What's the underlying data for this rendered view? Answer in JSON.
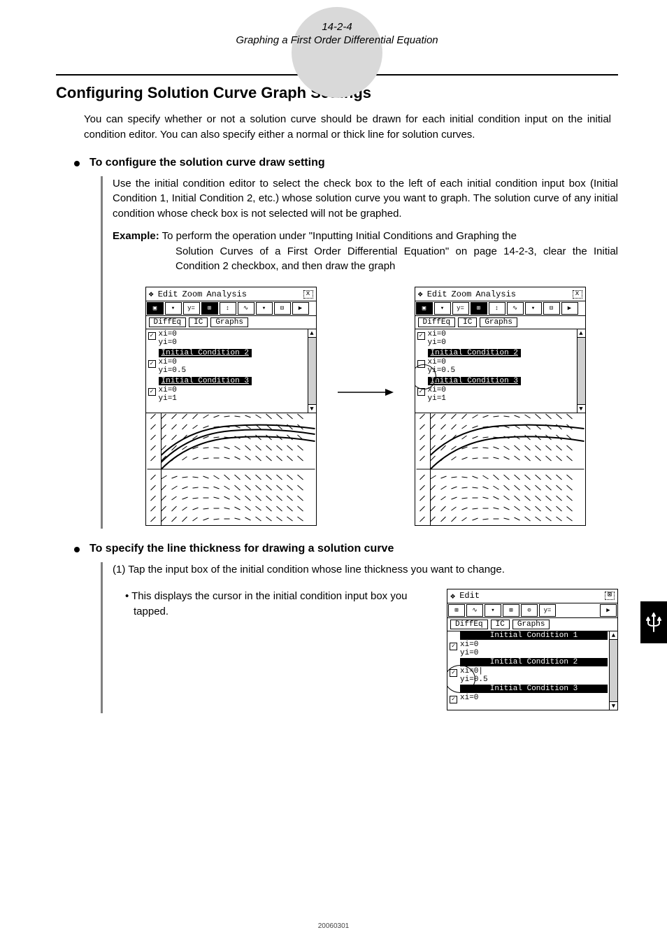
{
  "header": {
    "page_number": "14-2-4",
    "subtitle": "Graphing a First Order Differential Equation"
  },
  "section": {
    "title": "Configuring Solution Curve Graph Settings",
    "intro": "You can specify whether or not a solution curve should be drawn for each initial condition input on the initial condition editor. You can also specify either a normal or thick line for solution curves."
  },
  "sub1": {
    "heading": "To configure the solution curve draw setting",
    "para": "Use the initial condition editor to select the check box to the left of each initial condition input box (Initial Condition 1, Initial Condition 2, etc.) whose solution curve you want to graph. The solution curve of any initial condition whose check box is not selected will not be graphed.",
    "example_label": "Example:",
    "example_text_1": "To perform the operation under \"Inputting Initial Conditions and Graphing the",
    "example_text_2": "Solution Curves of a First Order Differential Equation\" on page 14-2-3, clear the Initial Condition 2 checkbox, and then draw the graph"
  },
  "calc_common": {
    "menus": [
      "Edit",
      "Zoom",
      "Analysis"
    ],
    "tabs": [
      "DiffEq",
      "IC",
      "Graphs"
    ],
    "cond1_xi": "xi=0",
    "cond1_yi": "yi=0",
    "sep2": "Initial Condition 2",
    "cond2_xi": "xi=0",
    "cond2_yi": "yi=0.5",
    "sep3": "Initial Condition 3",
    "cond3_xi": "xi=0",
    "cond3_yi": "yi=1"
  },
  "sub2": {
    "heading": "To specify the line thickness for drawing a solution curve",
    "step1": "(1) Tap the input box of the initial condition whose line thickness you want to change.",
    "bullet1": "• This displays the cursor in the initial condition input box you tapped."
  },
  "small_screen": {
    "menu": "Edit",
    "tabs": [
      "DiffEq",
      "IC",
      "Graphs"
    ],
    "sep1": "Initial Condition 1",
    "c1_xi": "xi=0",
    "c1_yi": "yi=0",
    "sep2": "Initial Condition 2",
    "c2_xi": "xi=0|",
    "c2_yi": "yi=0.5",
    "sep3": "Initial Condition 3",
    "c3_xi": "xi=0"
  },
  "footer": {
    "date": "20060301"
  }
}
